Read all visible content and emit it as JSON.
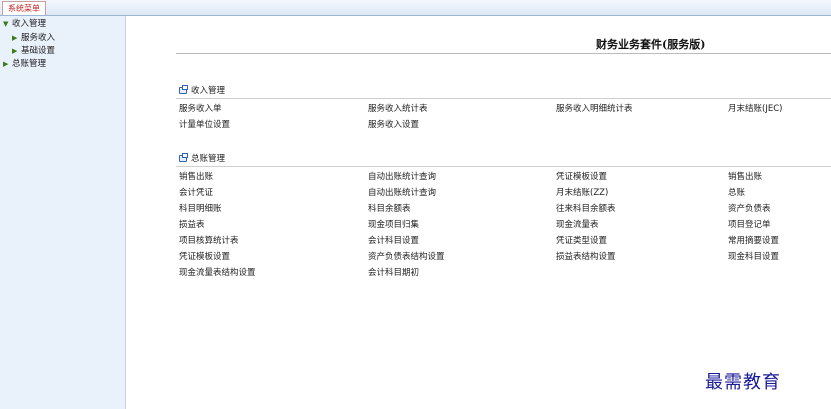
{
  "top_tab": "系统菜单",
  "sidebar": {
    "items": [
      {
        "label": "收入管理",
        "arrow": "▼"
      },
      {
        "label": "服务收入",
        "arrow": "▶"
      },
      {
        "label": "基础设置",
        "arrow": "▶"
      },
      {
        "label": "总账管理",
        "arrow": "▶"
      }
    ]
  },
  "main": {
    "title": "财务业务套件(服务版)",
    "sections": [
      {
        "title": "收入管理",
        "rows": [
          [
            "服务收入单",
            "服务收入统计表",
            "服务收入明细统计表",
            "月末结账(JEC)"
          ],
          [
            "计量单位设置",
            "服务收入设置",
            "",
            ""
          ]
        ]
      },
      {
        "title": "总账管理",
        "rows": [
          [
            "销售出账",
            "自动出账统计查询",
            "凭证模板设置",
            "销售出账"
          ],
          [
            "会计凭证",
            "自动出账统计查询",
            "月末结账(ZZ)",
            "总账"
          ],
          [
            "科目明细账",
            "科目余额表",
            "往来科目余额表",
            "资产负债表"
          ],
          [
            "损益表",
            "现金项目归集",
            "现金流量表",
            "项目登记单"
          ],
          [
            "项目核算统计表",
            "会计科目设置",
            "凭证类型设置",
            "常用摘要设置"
          ],
          [
            "凭证模板设置",
            "资产负债表结构设置",
            "损益表结构设置",
            "现金科目设置"
          ],
          [
            "现金流量表结构设置",
            "会计科目期初",
            "",
            ""
          ]
        ]
      }
    ]
  },
  "watermark": "最需教育",
  "colors": {
    "sidebar_bg": "#e9f1fb",
    "tab_text": "#c02020",
    "section_icon": "#2f62b0",
    "tree_arrow": "#3a7a1a",
    "watermark": "#1a1a99"
  }
}
